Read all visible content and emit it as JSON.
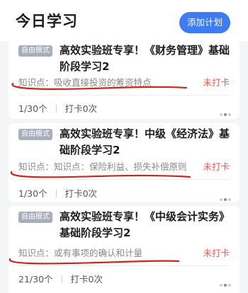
{
  "header": {
    "title": "今日学习",
    "add_button": "添加计划"
  },
  "cards": [
    {
      "mode": "自由模式",
      "title": "高效实验班专享！《财务管理》基础阶段学习2",
      "knowledge": "知识点：吸收直接投资的筹资特点",
      "status": "未打卡",
      "progress": "1/30个",
      "checkin": "打卡0次"
    },
    {
      "mode": "自由模式",
      "title": "高效实验班专享！中级《经济法》基础阶段学习2",
      "knowledge": "知识点：知识点：保险利益、损失补偿原则",
      "status": "未打卡",
      "progress": "1/30个",
      "checkin": "打卡0次"
    },
    {
      "mode": "自由模式",
      "title": "高效实验班专享！《中级会计实务》基础阶段学习2",
      "knowledge": "知识点：或有事项的确认和计量",
      "status": "未打卡",
      "progress": "21/30个",
      "checkin": "打卡0次"
    }
  ],
  "colors": {
    "accent": "#3d7cf5",
    "status_red": "#f2584f",
    "annotation_red": "#c8281e",
    "badge_gray": "#a7afbb"
  }
}
